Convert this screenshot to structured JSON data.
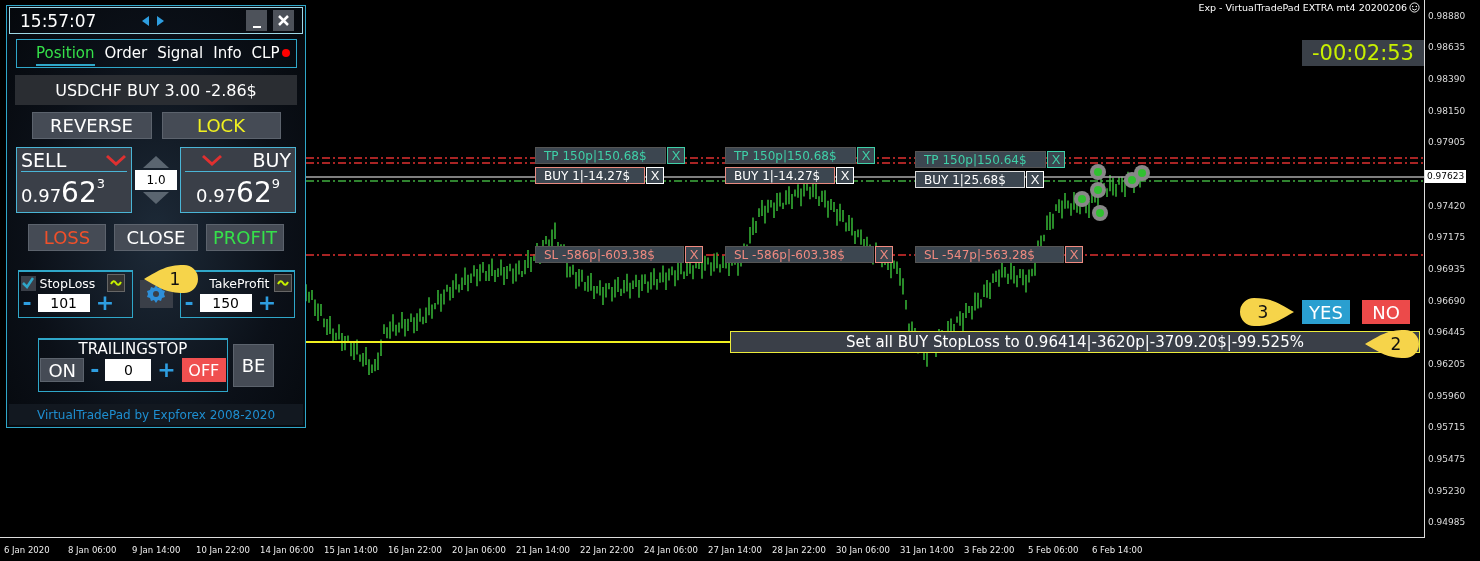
{
  "panel": {
    "time": "15:57:07",
    "tabs": [
      {
        "label": "Position",
        "selected": true
      },
      {
        "label": "Order",
        "selected": false
      },
      {
        "label": "Signal",
        "selected": false
      },
      {
        "label": "Info",
        "selected": false
      },
      {
        "label": "CLP",
        "selected": false,
        "alert": true
      }
    ],
    "summary": "USDCHF BUY 3.00 -2.86$",
    "reverse": "REVERSE",
    "lock": "LOCK",
    "sell": {
      "label": "SELL",
      "price": "0.97",
      "pips": "62",
      "point": "3"
    },
    "lot": "1.0",
    "buy": {
      "label": "BUY",
      "price": "0.97",
      "pips": "62",
      "point": "9"
    },
    "loss": "LOSS",
    "close": "CLOSE",
    "profit": "PROFIT",
    "stoploss": {
      "label": "StopLoss",
      "checked": true,
      "value": "101",
      "minus": "-",
      "plus": "+"
    },
    "takeprofit": {
      "label": "TakeProfit",
      "value": "150",
      "minus": "-",
      "plus": "+"
    },
    "trailing": {
      "title": "TRAILINGSTOP",
      "on": "ON",
      "minus": "-",
      "value": "0",
      "plus": "+",
      "off": "OFF"
    },
    "be": "BE",
    "footer": "VirtualTradePad by Expforex 2008-2020"
  },
  "chart": {
    "header": "Exp - VirtualTradePad EXTRA mt4 20200206",
    "timer": "-00:02:53",
    "orders": [
      {
        "tp": "TP 150p|150.68$",
        "tp_close": "X",
        "buy": "BUY 1|-14.27$",
        "buy_close": "X",
        "sl": "SL -586p|-603.38$",
        "sl_close": "X"
      },
      {
        "tp": "TP 150p|150.68$",
        "tp_close": "X",
        "buy": "BUY 1|-14.27$",
        "buy_close": "X",
        "sl": "SL -586p|-603.38$",
        "sl_close": "X"
      },
      {
        "tp": "TP 150p|150.64$",
        "tp_close": "X",
        "buy": "BUY 1|25.68$",
        "buy_close": "X",
        "sl": "SL -547p|-563.28$",
        "sl_close": "X"
      }
    ],
    "confirm": {
      "text": "Set all BUY StopLoss to 0.96414|-3620p|-3709.20$|-99.525%",
      "yes": "YES",
      "no": "NO"
    },
    "callouts": [
      "1",
      "2",
      "3"
    ],
    "price_ticks": [
      "0.98880",
      "0.98635",
      "0.98390",
      "0.98150",
      "0.97905",
      "0.97420",
      "0.97175",
      "0.96935",
      "0.96690",
      "0.96445",
      "0.96205",
      "0.95960",
      "0.95715",
      "0.95475",
      "0.95230",
      "0.94985"
    ],
    "current_price": "0.97623",
    "time_ticks": [
      "6 Jan 2020",
      "8 Jan 06:00",
      "9 Jan 14:00",
      "10 Jan 22:00",
      "14 Jan 06:00",
      "15 Jan 14:00",
      "16 Jan 22:00",
      "20 Jan 06:00",
      "21 Jan 14:00",
      "22 Jan 22:00",
      "24 Jan 06:00",
      "27 Jan 14:00",
      "28 Jan 22:00",
      "30 Jan 06:00",
      "31 Jan 14:00",
      "3 Feb 22:00",
      "5 Feb 06:00",
      "6 Feb 14:00"
    ]
  }
}
